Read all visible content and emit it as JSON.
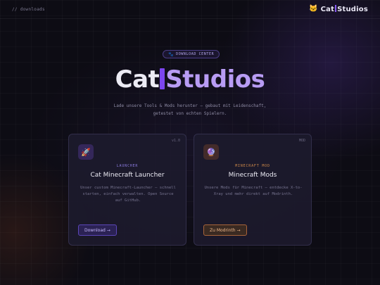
{
  "topbar": {
    "breadcrumb": "// downloads",
    "brand_icon": "cat-face-icon",
    "brand_icon_glyph": "🐱",
    "brand_left": "Cat",
    "brand_right": "Studios"
  },
  "badge": {
    "icon": "paw-icon",
    "icon_glyph": "🐾",
    "label": "DOWNLOAD CENTER"
  },
  "hero": {
    "left": "Cat",
    "right": "Studios"
  },
  "subtitle": "Lade unsere Tools & Mods herunter — gebaut mit Leidenschaft, getestet von echten Spielern.",
  "cards": [
    {
      "icon": "rocket-icon",
      "icon_glyph": "🚀",
      "version": "v1.0",
      "tag": "LAUNCHER",
      "title": "Cat Minecraft Launcher",
      "description": "Unser custom Minecraft-Launcher — schnell starten, einfach verwalten. Open Source auf GitHub.",
      "button": "Download →"
    },
    {
      "icon": "crystal-ball-icon",
      "icon_glyph": "🔮",
      "version": "MOD",
      "tag": "MINECRAFT MOD",
      "title": "Minecraft Mods",
      "description": "Unsere Mods für Minecraft — entdecke X-to-Xray und mehr direkt auf Modrinth.",
      "button": "Zu Modrinth →"
    }
  ],
  "colors": {
    "accent": "#7c45f0",
    "accent_light": "#b89cf4",
    "warm": "#d08a4a",
    "background": "#0d0c14"
  }
}
